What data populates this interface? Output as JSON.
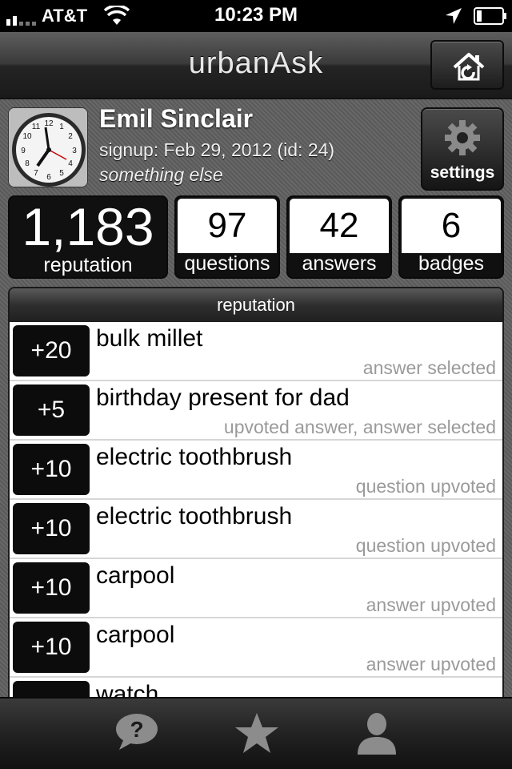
{
  "status": {
    "carrier": "AT&T",
    "time": "10:23 PM"
  },
  "nav": {
    "title": "urbanAsk"
  },
  "user": {
    "name": "Emil Sinclair",
    "signup": "signup: Feb 29, 2012 (id: 24)",
    "about": "something else"
  },
  "settings_label": "settings",
  "stats": {
    "reputation": {
      "value": "1,183",
      "label": "reputation"
    },
    "questions": {
      "value": "97",
      "label": "questions"
    },
    "answers": {
      "value": "42",
      "label": "answers"
    },
    "badges": {
      "value": "6",
      "label": "badges"
    }
  },
  "reputation_section": {
    "header": "reputation",
    "items": [
      {
        "points": "+20",
        "question": "bulk millet",
        "reason": "answer selected"
      },
      {
        "points": "+5",
        "question": "birthday present for dad",
        "reason": "upvoted answer, answer selected"
      },
      {
        "points": "+10",
        "question": "electric toothbrush",
        "reason": "question upvoted"
      },
      {
        "points": "+10",
        "question": "electric toothbrush",
        "reason": "question upvoted"
      },
      {
        "points": "+10",
        "question": "carpool",
        "reason": "answer upvoted"
      },
      {
        "points": "+10",
        "question": "carpool",
        "reason": "answer upvoted"
      },
      {
        "points": "",
        "question": "watch",
        "reason": ""
      }
    ]
  },
  "tabbar": {
    "icons": [
      "question-bubble-icon",
      "star-icon",
      "person-icon"
    ]
  }
}
